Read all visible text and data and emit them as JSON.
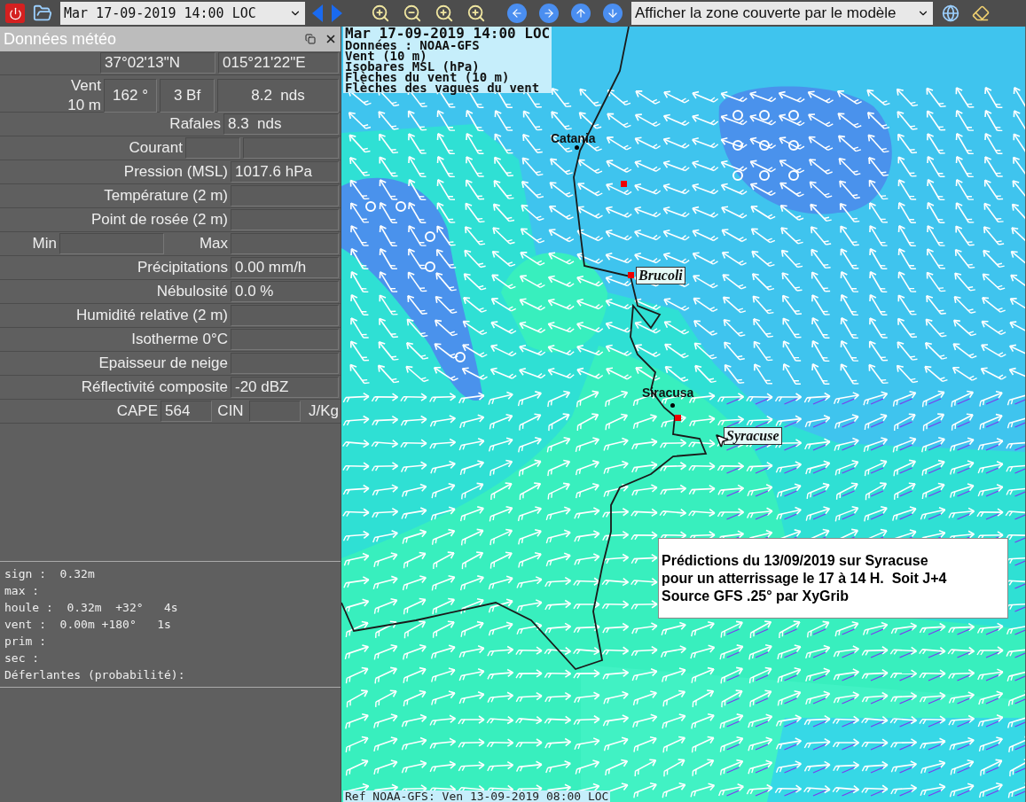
{
  "toolbar": {
    "date_select": "Mar 17-09-2019 14:00 LOC",
    "zone_select": "Afficher la zone couverte par le modèle"
  },
  "panel": {
    "title": "Données météo",
    "rows": [
      {
        "kind": "coords",
        "values": [
          "37°02'13\"N",
          "015°21'22\"E"
        ]
      },
      {
        "kind": "wind",
        "label": [
          "Vent",
          "10 m"
        ],
        "values": [
          "162 °",
          "3 Bf",
          "8.2  nds"
        ]
      },
      {
        "kind": "single",
        "label": "Rafales",
        "values": [
          "8.3  nds"
        ]
      },
      {
        "kind": "pair",
        "label": "Courant"
      },
      {
        "kind": "value",
        "label": "Pression (MSL)",
        "values": [
          "1017.6 hPa"
        ]
      },
      {
        "kind": "value",
        "label": "Température (2 m)"
      },
      {
        "kind": "value",
        "label": "Point de rosée (2 m)"
      },
      {
        "kind": "minmax",
        "label": "Min",
        "label2": "Max"
      },
      {
        "kind": "value",
        "label": "Précipitations",
        "values": [
          "0.00 mm/h"
        ]
      },
      {
        "kind": "value",
        "label": "Nébulosité",
        "values": [
          "0.0 %"
        ]
      },
      {
        "kind": "value",
        "label": "Humidité relative (2 m)"
      },
      {
        "kind": "value",
        "label": "Isotherme 0°C"
      },
      {
        "kind": "value",
        "label": "Epaisseur de neige"
      },
      {
        "kind": "value",
        "label": "Réflectivité composite",
        "values": [
          "-20 dBZ"
        ]
      },
      {
        "kind": "cape",
        "label": "CAPE",
        "label2": "CIN",
        "unit": "J/Kg",
        "values": [
          "564"
        ]
      }
    ],
    "wave_lines": [
      "sign :  0.32m",
      "max :",
      "houle :  0.32m  +32°   4s",
      "vent :  0.00m +180°   1s",
      "prim :",
      "sec :",
      "Déferlantes (probabilité):"
    ]
  },
  "map": {
    "info_lines": [
      "Mar 17-09-2019 14:00 LOC",
      "Données : NOAA-GFS",
      "Vent (10 m)",
      "Isobares MSL (hPa)",
      "Flèches du vent (10 m)",
      "Flèches des vagues du vent"
    ],
    "places": [
      {
        "name": "Catania",
        "kind": "city"
      },
      {
        "name": "Brucoli",
        "kind": "waypoint"
      },
      {
        "name": "Siracusa",
        "kind": "city"
      },
      {
        "name": "Syracuse",
        "kind": "waypoint"
      }
    ],
    "note_lines": [
      "Prédictions du 13/09/2019 sur Syracuse",
      "pour un atterrissage le 17 à 14 H.  Soit J+4",
      "Source GFS .25° par XyGrib"
    ],
    "footer": "Ref NOAA-GFS: Ven 13-09-2019 08:00 LOC"
  }
}
